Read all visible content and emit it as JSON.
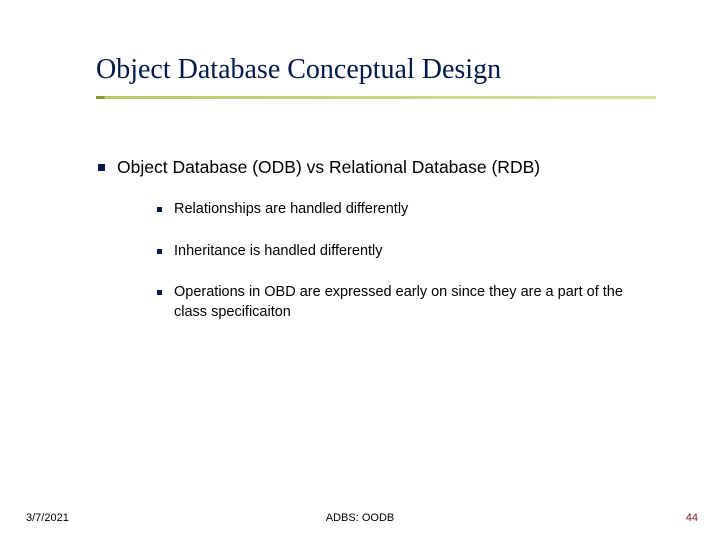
{
  "title": "Object Database Conceptual Design",
  "level1": "Object Database (ODB) vs Relational Database (RDB)",
  "level2": {
    "0": "Relationships are handled differently",
    "1": "Inheritance is handled differently",
    "2": "Operations in OBD are expressed early on since they are a part of the class specificaiton"
  },
  "footer": {
    "date": "3/7/2021",
    "center": "ADBS: OODB",
    "page": "44"
  }
}
